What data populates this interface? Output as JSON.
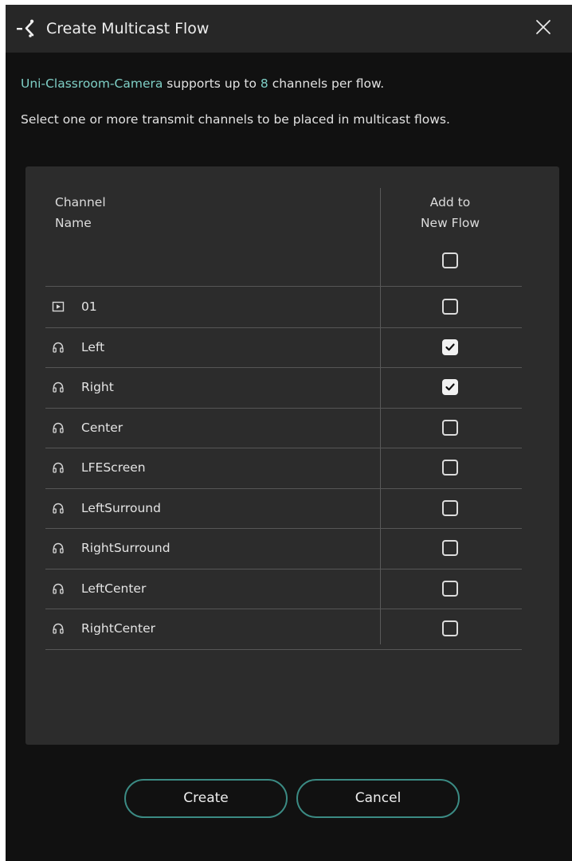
{
  "dialog": {
    "title": "Create Multicast Flow",
    "close_icon": "close-icon",
    "logo_icon": "app-logo-icon"
  },
  "intro": {
    "device_name": "Uni-Classroom-Camera",
    "text_a": " supports up to ",
    "channel_limit": "8",
    "text_b": " channels per flow.",
    "line2": "Select one or more transmit channels to be placed in multicast flows."
  },
  "table": {
    "col_name_line1": "Channel",
    "col_name_line2": "Name",
    "col_add_line1": "Add to",
    "col_add_line2": "New Flow",
    "select_all_checked": false,
    "rows": [
      {
        "icon": "video-icon",
        "name": "01",
        "checked": false
      },
      {
        "icon": "headphones-icon",
        "name": "Left",
        "checked": true
      },
      {
        "icon": "headphones-icon",
        "name": "Right",
        "checked": true
      },
      {
        "icon": "headphones-icon",
        "name": "Center",
        "checked": false
      },
      {
        "icon": "headphones-icon",
        "name": "LFEScreen",
        "checked": false
      },
      {
        "icon": "headphones-icon",
        "name": "LeftSurround",
        "checked": false
      },
      {
        "icon": "headphones-icon",
        "name": "RightSurround",
        "checked": false
      },
      {
        "icon": "headphones-icon",
        "name": "LeftCenter",
        "checked": false
      },
      {
        "icon": "headphones-icon",
        "name": "RightCenter",
        "checked": false
      }
    ]
  },
  "buttons": {
    "create_label": "Create",
    "cancel_label": "Cancel"
  },
  "colors": {
    "accent": "#7fcfc6",
    "button_border": "#3b8b84",
    "background": "#111111",
    "panel": "#2c2c2c",
    "titlebar": "#272727"
  }
}
